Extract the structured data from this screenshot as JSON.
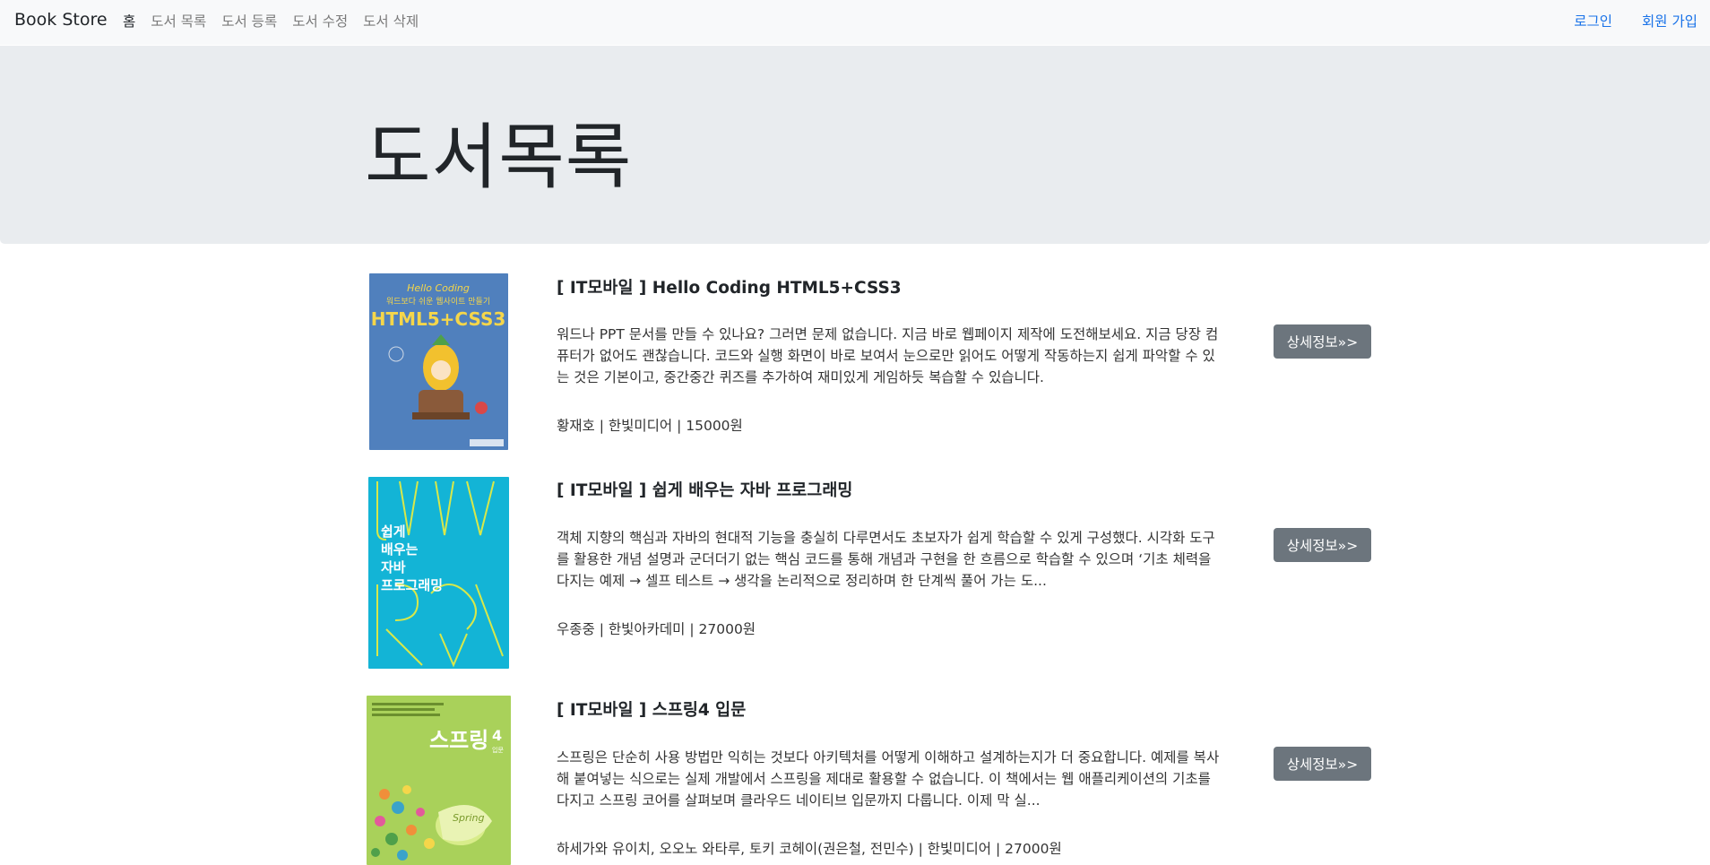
{
  "navbar": {
    "brand": "Book Store",
    "left_items": [
      {
        "label": "홈",
        "active": true
      },
      {
        "label": "도서 목록"
      },
      {
        "label": "도서 등록"
      },
      {
        "label": "도서 수정"
      },
      {
        "label": "도서 삭제"
      }
    ],
    "right_items": [
      {
        "label": "로그인"
      },
      {
        "label": "회원 가입"
      }
    ]
  },
  "jumbotron": {
    "title": "도서목록"
  },
  "books": [
    {
      "title": "[ IT모바일 ] Hello Coding HTML5+CSS3",
      "description": "워드나 PPT 문서를 만들 수 있나요? 그러면 문제 없습니다. 지금 바로 웹페이지 제작에 도전해보세요. 지금 당장 컴퓨터가 없어도 괜찮습니다. 코드와 실행 화면이 바로 보여서 눈으로만 읽어도 어떻게 작동하는지 쉽게 파악할 수 있는 것은 기본이고, 중간중간 퀴즈를 추가하여 재미있게 게임하듯 복습할 수 있습니다.",
      "meta": "황재호 | 한빛미디어 | 15000원",
      "button": "상세정보»>",
      "cover_text": "Hello Coding 위드보다 쉬운 웹사이트 만들기 HTML5+CSS3"
    },
    {
      "title": "[ IT모바일 ] 쉽게 배우는 자바 프로그래밍",
      "description": "객체 지향의 핵심과 자바의 현대적 기능을 충실히 다루면서도 초보자가 쉽게 학습할 수 있게 구성했다. 시각화 도구를 활용한 개념 설명과 군더더기 없는 핵심 코드를 통해 개념과 구현을 한 흐름으로 학습할 수 있으며 ‘기초 체력을 다지는 예제 → 셀프 테스트 → 생각을 논리적으로 정리하며 한 단계씩 풀어 가는 도...",
      "meta": "우종중 | 한빛아카데미 | 27000원",
      "button": "상세정보»>",
      "cover_text": "쉽게 배우는 자바 프로그래밍"
    },
    {
      "title": "[ IT모바일 ] 스프링4 입문",
      "description": "스프링은 단순히 사용 방법만 익히는 것보다 아키텍처를 어떻게 이해하고 설계하는지가 더 중요합니다. 예제를 복사해 붙여넣는 식으로는 실제 개발에서 스프링을 제대로 활용할 수 없습니다. 이 책에서는 웹 애플리케이션의 기초를 다지고 스프링 코어를 살펴보며 클라우드 네이티브 입문까지 다룹니다. 이제 막 실...",
      "meta": "하세가와 유이치, 오오노 와타루, 토키 코헤이(권은철, 전민수) | 한빛미디어 | 27000원",
      "button": "상세정보»>",
      "cover_text": "스프링4 입문"
    }
  ],
  "colors": {
    "navbar_bg": "#f8f9fa",
    "jumbotron_bg": "#e9ecef",
    "link_blue": "#1a73e8",
    "button_gray": "#6c757d"
  }
}
